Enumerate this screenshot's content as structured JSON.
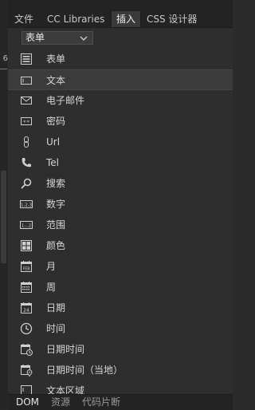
{
  "left_edge": {
    "fragment": "6"
  },
  "tabs": [
    {
      "label": "文件",
      "active": false
    },
    {
      "label": "CC Libraries",
      "active": false
    },
    {
      "label": "插入",
      "active": true
    },
    {
      "label": "CSS 设计器",
      "active": false
    }
  ],
  "category_dropdown": {
    "value": "表单"
  },
  "items": [
    {
      "label": "表单",
      "icon": "form-icon"
    },
    {
      "label": "文本",
      "icon": "text-field-icon",
      "selected": true
    },
    {
      "label": "电子邮件",
      "icon": "email-icon"
    },
    {
      "label": "密码",
      "icon": "password-icon"
    },
    {
      "label": "Url",
      "icon": "link-icon"
    },
    {
      "label": "Tel",
      "icon": "phone-icon"
    },
    {
      "label": "搜索",
      "icon": "search-icon"
    },
    {
      "label": "数字",
      "icon": "number-icon"
    },
    {
      "label": "范围",
      "icon": "range-icon"
    },
    {
      "label": "颜色",
      "icon": "color-icon"
    },
    {
      "label": "月",
      "icon": "month-icon"
    },
    {
      "label": "周",
      "icon": "week-icon"
    },
    {
      "label": "日期",
      "icon": "date-icon"
    },
    {
      "label": "时间",
      "icon": "time-icon"
    },
    {
      "label": "日期时间",
      "icon": "datetime-icon"
    },
    {
      "label": "日期时间（当地）",
      "icon": "datetime-local-icon"
    },
    {
      "label": "文本区域",
      "icon": "textarea-icon"
    }
  ],
  "bottom_tabs": [
    {
      "label": "DOM",
      "active": true
    },
    {
      "label": "资源",
      "active": false
    },
    {
      "label": "代码片断",
      "active": false
    }
  ],
  "calendar_labels": {
    "month": "FEB",
    "date": "24"
  }
}
